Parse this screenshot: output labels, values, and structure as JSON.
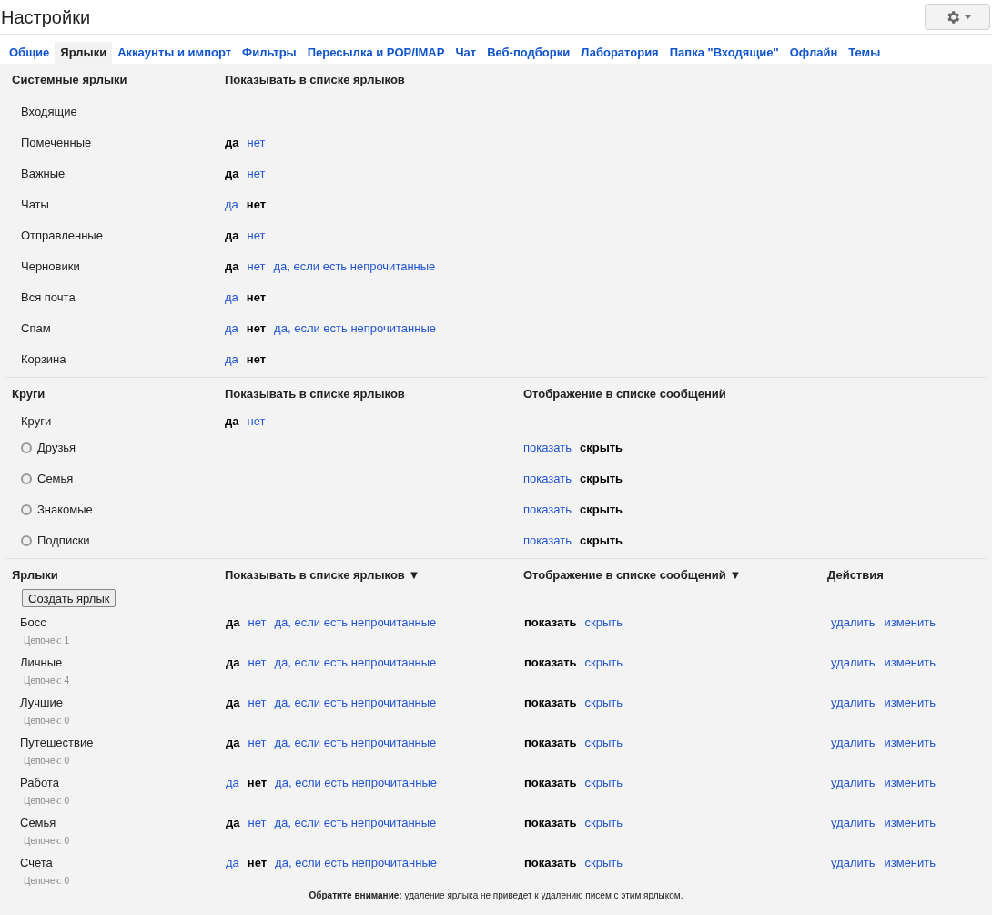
{
  "title": "Настройки",
  "tabs": [
    {
      "label": "Общие",
      "selected": false
    },
    {
      "label": "Ярлыки",
      "selected": true
    },
    {
      "label": "Аккаунты и импорт",
      "selected": false
    },
    {
      "label": "Фильтры",
      "selected": false
    },
    {
      "label": "Пересылка и POP/IMAP",
      "selected": false
    },
    {
      "label": "Чат",
      "selected": false
    },
    {
      "label": "Веб-подборки",
      "selected": false
    },
    {
      "label": "Лаборатория",
      "selected": false
    },
    {
      "label": "Папка \"Входящие\"",
      "selected": false
    },
    {
      "label": "Офлайн",
      "selected": false
    },
    {
      "label": "Темы",
      "selected": false
    }
  ],
  "system": {
    "heading": "Системные ярлыки",
    "column_heading": "Показывать в списке ярлыков",
    "rows": [
      {
        "name": "Входящие",
        "options": []
      },
      {
        "name": "Помеченные",
        "options": [
          {
            "label": "да",
            "selected": true
          },
          {
            "label": "нет",
            "selected": false
          }
        ]
      },
      {
        "name": "Важные",
        "options": [
          {
            "label": "да",
            "selected": true
          },
          {
            "label": "нет",
            "selected": false
          }
        ]
      },
      {
        "name": "Чаты",
        "options": [
          {
            "label": "да",
            "selected": false
          },
          {
            "label": "нет",
            "selected": true
          }
        ]
      },
      {
        "name": "Отправленные",
        "options": [
          {
            "label": "да",
            "selected": true
          },
          {
            "label": "нет",
            "selected": false
          }
        ]
      },
      {
        "name": "Черновики",
        "options": [
          {
            "label": "да",
            "selected": true
          },
          {
            "label": "нет",
            "selected": false
          },
          {
            "label": "да, если есть непрочитанные",
            "selected": false
          }
        ]
      },
      {
        "name": "Вся почта",
        "options": [
          {
            "label": "да",
            "selected": false
          },
          {
            "label": "нет",
            "selected": true
          }
        ]
      },
      {
        "name": "Спам",
        "options": [
          {
            "label": "да",
            "selected": false
          },
          {
            "label": "нет",
            "selected": true
          },
          {
            "label": "да, если есть непрочитанные",
            "selected": false
          }
        ]
      },
      {
        "name": "Корзина",
        "options": [
          {
            "label": "да",
            "selected": false
          },
          {
            "label": "нет",
            "selected": true
          }
        ]
      }
    ]
  },
  "circles": {
    "heading": "Круги",
    "column_heading": "Показывать в списке ярлыков",
    "column_heading_2": "Отображение в списке сообщений",
    "main": {
      "name": "Круги",
      "options": [
        {
          "label": "да",
          "selected": true
        },
        {
          "label": "нет",
          "selected": false
        }
      ]
    },
    "items": [
      {
        "name": "Друзья",
        "message_options": [
          {
            "label": "показать",
            "selected": false
          },
          {
            "label": "скрыть",
            "selected": true
          }
        ]
      },
      {
        "name": "Семья",
        "message_options": [
          {
            "label": "показать",
            "selected": false
          },
          {
            "label": "скрыть",
            "selected": true
          }
        ]
      },
      {
        "name": "Знакомые",
        "message_options": [
          {
            "label": "показать",
            "selected": false
          },
          {
            "label": "скрыть",
            "selected": true
          }
        ]
      },
      {
        "name": "Подписки",
        "message_options": [
          {
            "label": "показать",
            "selected": false
          },
          {
            "label": "скрыть",
            "selected": true
          }
        ]
      }
    ]
  },
  "labels": {
    "heading": "Ярлыки",
    "column_heading": "Показывать в списке ярлыков ▼",
    "column_heading_2": "Отображение в списке сообщений ▼",
    "column_heading_3": "Действия",
    "create_button": "Создать ярлык",
    "rows": [
      {
        "name": "Босс",
        "count": "Цепочек: 1",
        "options": [
          {
            "label": "да",
            "selected": true
          },
          {
            "label": "нет",
            "selected": false
          },
          {
            "label": "да, если есть непрочитанные",
            "selected": false
          }
        ],
        "message_options": [
          {
            "label": "показать",
            "selected": true
          },
          {
            "label": "скрыть",
            "selected": false
          }
        ],
        "actions": [
          "удалить",
          "изменить"
        ]
      },
      {
        "name": "Личные",
        "count": "Цепочек: 4",
        "options": [
          {
            "label": "да",
            "selected": true
          },
          {
            "label": "нет",
            "selected": false
          },
          {
            "label": "да, если есть непрочитанные",
            "selected": false
          }
        ],
        "message_options": [
          {
            "label": "показать",
            "selected": true
          },
          {
            "label": "скрыть",
            "selected": false
          }
        ],
        "actions": [
          "удалить",
          "изменить"
        ]
      },
      {
        "name": "Лучшие",
        "count": "Цепочек: 0",
        "options": [
          {
            "label": "да",
            "selected": true
          },
          {
            "label": "нет",
            "selected": false
          },
          {
            "label": "да, если есть непрочитанные",
            "selected": false
          }
        ],
        "message_options": [
          {
            "label": "показать",
            "selected": true
          },
          {
            "label": "скрыть",
            "selected": false
          }
        ],
        "actions": [
          "удалить",
          "изменить"
        ]
      },
      {
        "name": "Путешествие",
        "count": "Цепочек: 0",
        "options": [
          {
            "label": "да",
            "selected": true
          },
          {
            "label": "нет",
            "selected": false
          },
          {
            "label": "да, если есть непрочитанные",
            "selected": false
          }
        ],
        "message_options": [
          {
            "label": "показать",
            "selected": true
          },
          {
            "label": "скрыть",
            "selected": false
          }
        ],
        "actions": [
          "удалить",
          "изменить"
        ]
      },
      {
        "name": "Работа",
        "count": "Цепочек: 0",
        "options": [
          {
            "label": "да",
            "selected": false
          },
          {
            "label": "нет",
            "selected": true
          },
          {
            "label": "да, если есть непрочитанные",
            "selected": false
          }
        ],
        "message_options": [
          {
            "label": "показать",
            "selected": true
          },
          {
            "label": "скрыть",
            "selected": false
          }
        ],
        "actions": [
          "удалить",
          "изменить"
        ]
      },
      {
        "name": "Семья",
        "count": "Цепочек: 0",
        "options": [
          {
            "label": "да",
            "selected": true
          },
          {
            "label": "нет",
            "selected": false
          },
          {
            "label": "да, если есть непрочитанные",
            "selected": false
          }
        ],
        "message_options": [
          {
            "label": "показать",
            "selected": true
          },
          {
            "label": "скрыть",
            "selected": false
          }
        ],
        "actions": [
          "удалить",
          "изменить"
        ]
      },
      {
        "name": "Счета",
        "count": "Цепочек: 0",
        "options": [
          {
            "label": "да",
            "selected": false
          },
          {
            "label": "нет",
            "selected": true
          },
          {
            "label": "да, если есть непрочитанные",
            "selected": false
          }
        ],
        "message_options": [
          {
            "label": "показать",
            "selected": true
          },
          {
            "label": "скрыть",
            "selected": false
          }
        ],
        "actions": [
          "удалить",
          "изменить"
        ]
      }
    ]
  },
  "note": "**Обратите внимание:** удаление ярлыка не приведет к удалению писем с этим ярлыком."
}
